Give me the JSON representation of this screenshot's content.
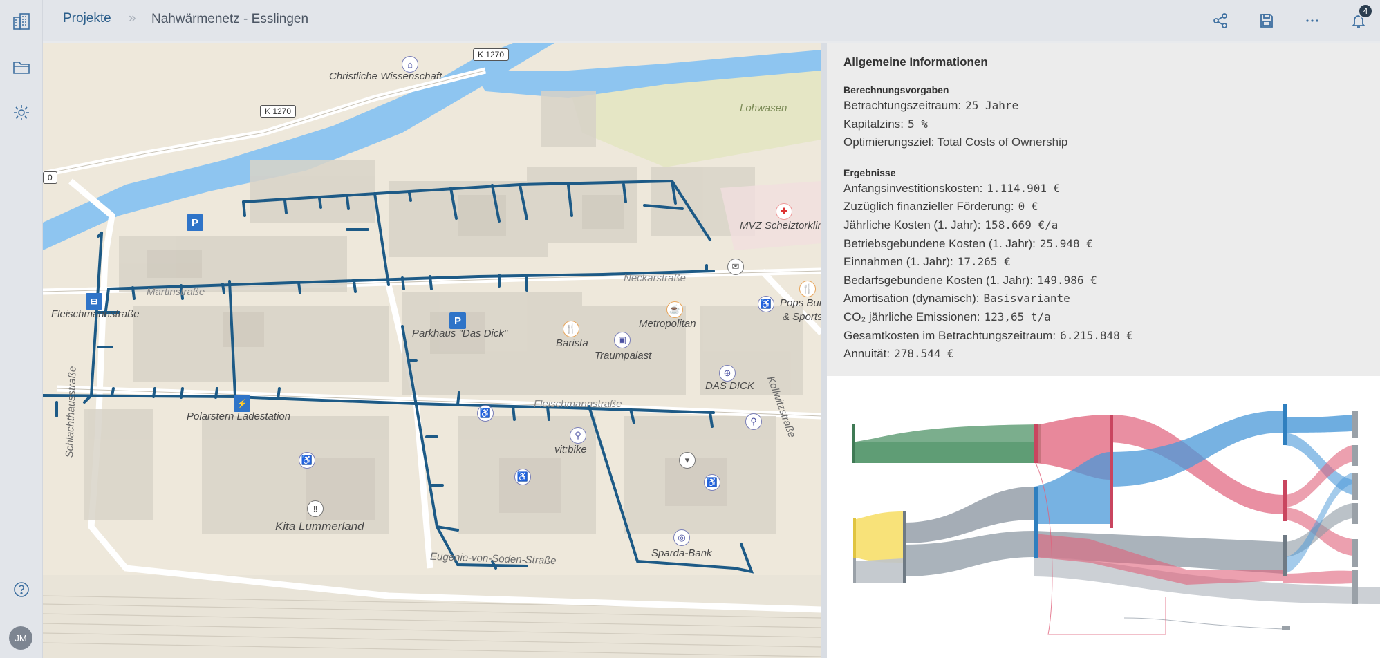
{
  "sidebar": {
    "items": [
      {
        "icon": "buildings-icon"
      },
      {
        "icon": "folder-icon"
      },
      {
        "icon": "gear-icon"
      }
    ],
    "help_icon": "help-icon",
    "avatar_initials": "JM"
  },
  "header": {
    "breadcrumb_root": "Projekte",
    "breadcrumb_separator": "»",
    "breadcrumb_current": "Nahwärmenetz - Esslingen",
    "actions": [
      "share-icon",
      "save-icon",
      "more-icon",
      "bell-icon"
    ],
    "notification_count": "4"
  },
  "map": {
    "labels": {
      "christliche": "Christliche Wissenschaft",
      "lohwasen": "Lohwasen",
      "mvz": "MVZ Schelztorklin",
      "fleischmann": "Fleischmannstraße",
      "parkhaus": "Parkhaus \"Das Dick\"",
      "barista": "Barista",
      "metropolitan": "Metropolitan",
      "traumpalast": "Traumpalast",
      "dasdick": "DAS DICK",
      "pops": "Pops Burg",
      "sports": "& Sports",
      "polarstern": "Polarstern Ladestation",
      "vitbike": "vit:bike",
      "kita": "Kita Lummerland",
      "sparda": "Sparda-Bank",
      "eugenie": "Eugenie-von-Soden-Straße",
      "schlachthaus": "Schlachthausstraße",
      "kollwitz": "Kollwitzstraße",
      "fleisch2": "Fleischmannstraße",
      "martin": "Martinstraße",
      "neckar": "Neckarstraße",
      "k1270a": "K 1270",
      "k1270b": "K 1270",
      "zero": "0"
    }
  },
  "info": {
    "title": "Allgemeine Informationen",
    "section1": "Berechnungsvorgaben",
    "betrachtung_label": "Betrachtungszeitraum:",
    "betrachtung_value": "25 Jahre",
    "kapital_label": "Kapitalzins:",
    "kapital_value": "5 %",
    "ziel_label": "Optimierungsziel:",
    "ziel_value": "Total Costs of Ownership",
    "section2": "Ergebnisse",
    "results": [
      {
        "label": "Anfangsinvestitionskosten:",
        "value": "1.114.901 €"
      },
      {
        "label": "Zuzüglich finanzieller Förderung:",
        "value": "0 €"
      },
      {
        "label": "Jährliche Kosten (1. Jahr):",
        "value": "158.669 €/a"
      },
      {
        "label": "Betriebsgebundene Kosten (1. Jahr):",
        "value": "25.948 €"
      },
      {
        "label": "Einnahmen (1. Jahr):",
        "value": "17.265 €"
      },
      {
        "label": "Bedarfsgebundene Kosten (1. Jahr):",
        "value": "149.986 €"
      },
      {
        "label": "Amortisation (dynamisch):",
        "value": "Basisvariante"
      },
      {
        "label": "CO₂ jährliche Emissionen:",
        "value": "123,65 t/a"
      },
      {
        "label": "Gesamtkosten im Betrachtungszeitraum:",
        "value": "6.215.848 €"
      },
      {
        "label": "Annuität:",
        "value": "278.544 €"
      }
    ]
  },
  "colors": {
    "pipe": "#1d5a86",
    "river": "#8ec5f0",
    "accent": "#2a5d8a",
    "sankey_green": "#5a9a70",
    "sankey_yellow": "#f7df6a",
    "sankey_gray": "#8e99a4",
    "sankey_red": "#e0607a",
    "sankey_blue": "#4a98d8"
  }
}
